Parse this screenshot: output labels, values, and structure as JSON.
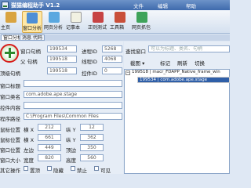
{
  "window": {
    "title": "猫猫编程助手 V1.2",
    "menus": [
      "文件",
      "编辑",
      "帮助"
    ]
  },
  "toolbar": {
    "buttons": [
      {
        "label": "主页",
        "icon": "home-icon"
      },
      {
        "label": "窗口分析",
        "icon": "window-analysis-icon"
      },
      {
        "label": "网页分析",
        "icon": "web-analysis-icon"
      },
      {
        "label": "记事本",
        "icon": "notepad-icon"
      },
      {
        "label": "正则测试",
        "icon": "regex-test-icon"
      },
      {
        "label": "工具箱",
        "icon": "toolbox-icon"
      },
      {
        "label": "网页抓包",
        "icon": "web-capture-icon"
      }
    ]
  },
  "tabs": [
    "窗口分析",
    "消息 代码"
  ],
  "left": {
    "rows": [
      {
        "label": "窗口句柄",
        "value": "199534",
        "label2": "进程ID",
        "value2": "5268"
      },
      {
        "label": "父 句柄",
        "value": "199518",
        "label2": "线程ID",
        "value2": "4068"
      },
      {
        "label": "顶级句柄",
        "value": "199518",
        "label2": "控件ID",
        "value2": "0"
      }
    ],
    "wide_rows": [
      {
        "label": "窗口标题",
        "value": ""
      },
      {
        "label": "窗口类名",
        "value": "com.adobe.ape.stage"
      },
      {
        "label": "控件内容",
        "value": ""
      },
      {
        "label": "程序路径",
        "value": "C:\\Program Files\\Common Files"
      }
    ],
    "coords": [
      {
        "label": "鼠标位置",
        "k1": "横 X",
        "v1": "212",
        "k2": "纵 Y",
        "v2": "12"
      },
      {
        "label": "鼠标位置",
        "k1": "横 X",
        "v1": "661",
        "k2": "纵 Y",
        "v2": "362"
      },
      {
        "label": "窗口位置",
        "k1": "左边",
        "v1": "449",
        "k2": "顶边",
        "v2": "350"
      },
      {
        "label": "窗口大小",
        "k1": "宽度",
        "v1": "820",
        "k2": "高度",
        "v2": "560"
      }
    ],
    "other_ops": {
      "label": "其它操作",
      "options": [
        "置顶",
        "隐藏",
        "禁止",
        "可见"
      ]
    }
  },
  "right": {
    "find_label": "查找窗口",
    "find_placeholder": "可以为标题、类名、句柄",
    "controls": [
      "截图",
      "标记",
      "刷新",
      "切换"
    ],
    "tree": {
      "node1": "199518 | macr_FDAPP_Native_frame_win",
      "node2": "199534 | com.adobe.ape.stage"
    }
  }
}
